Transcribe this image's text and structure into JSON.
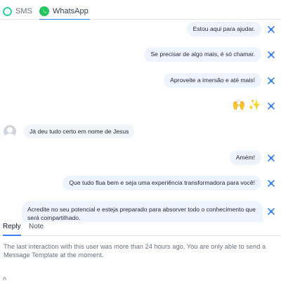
{
  "tabs": {
    "sms_label": "SMS",
    "whatsapp_label": "WhatsApp"
  },
  "messages": {
    "m1": "Estou aqui para ajudar.",
    "m2": "Se precisar de algo mais, é só chamar.",
    "m3": "Aproveite a imersão e até mais!",
    "m4_emojis": "🙌 ✨",
    "incoming1": "Já deu tudo certo em nome de Jesus",
    "m5": "Amém!",
    "m6": "Que tudo flua bem e seja uma experiência transformadora para você!",
    "m7": "Acredite no seu potencial e esteja preparado para absorver todo o conhecimento que será compartilhado."
  },
  "composer": {
    "reply_tab": "Reply",
    "note_tab": "Note",
    "notice": "The last interaction with this user was more than 24 hours ago. You are only able to send a Message Template at the moment."
  },
  "icons": {
    "message_status": "failed-x-icon",
    "avatar": "user-avatar-placeholder"
  },
  "colors": {
    "accent": "#3b82f6",
    "sms_ring": "#34d399",
    "whatsapp": "#22c55e",
    "outgoing_bubble": "#eef4fe",
    "status_icon": "#3b82f6"
  }
}
